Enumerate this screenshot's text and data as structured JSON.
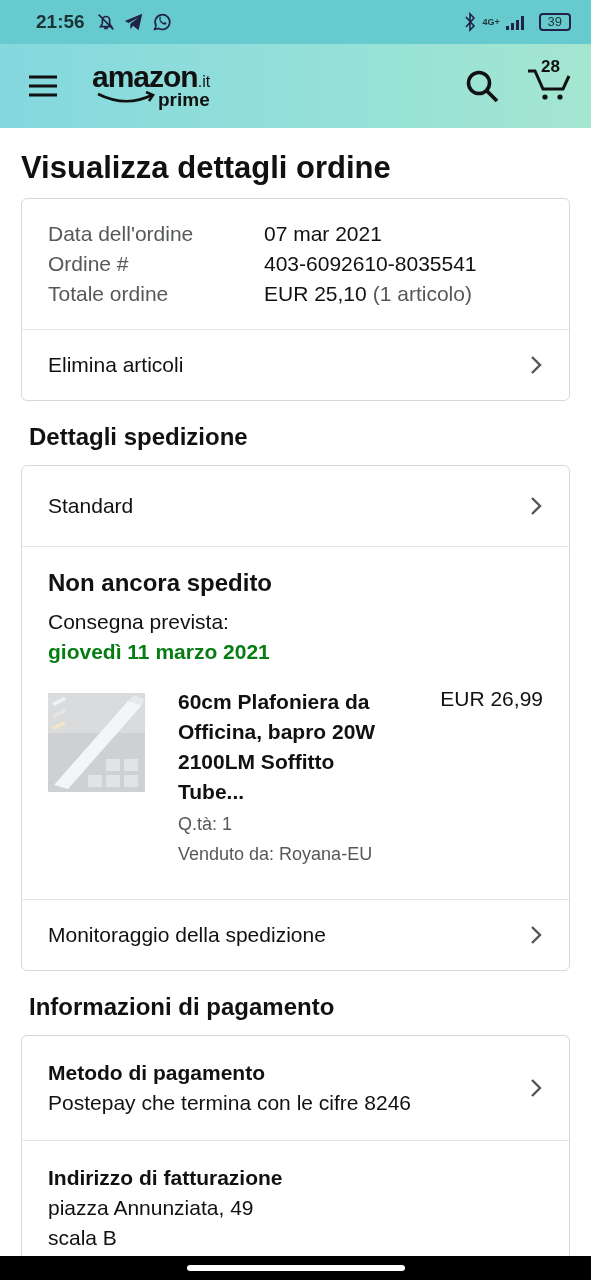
{
  "status_bar": {
    "time": "21:56",
    "network": "4G+",
    "battery": "39"
  },
  "header": {
    "logo": {
      "brand": "amazon",
      "domain": ".it",
      "tier": "prime"
    },
    "cart_count": "28"
  },
  "title": "Visualizza dettagli ordine",
  "summary": {
    "rows": [
      {
        "label": "Data dell'ordine",
        "value": "07 mar 2021"
      },
      {
        "label": "Ordine #",
        "value": "403-6092610-8035541"
      },
      {
        "label": "Totale ordine",
        "value": "EUR 25,10",
        "note": "(1 articolo)"
      }
    ],
    "action": "Elimina articoli"
  },
  "shipping": {
    "heading": "Dettagli spedizione",
    "method": "Standard",
    "status": "Non ancora spedito",
    "delivery_label": "Consegna prevista:",
    "delivery_date": "giovedì 11 marzo 2021",
    "item": {
      "title": "60cm Plafoniera da Officina, bapro 20W 2100LM Soffitto Tube...",
      "price": "EUR 26,99",
      "quantity": "Q.tà: 1",
      "seller": "Venduto da: Royana-EU"
    },
    "tracking": "Monitoraggio della spedizione"
  },
  "payment": {
    "heading": "Informazioni di pagamento",
    "sections": [
      {
        "kind": "link",
        "title": "Metodo di pagamento",
        "lines": [
          "Postepay che termina con le cifre 8246"
        ]
      },
      {
        "kind": "plain",
        "title": "Indirizzo di fatturazione",
        "lines": [
          "piazza Annunziata, 49",
          "scala B"
        ]
      }
    ]
  }
}
